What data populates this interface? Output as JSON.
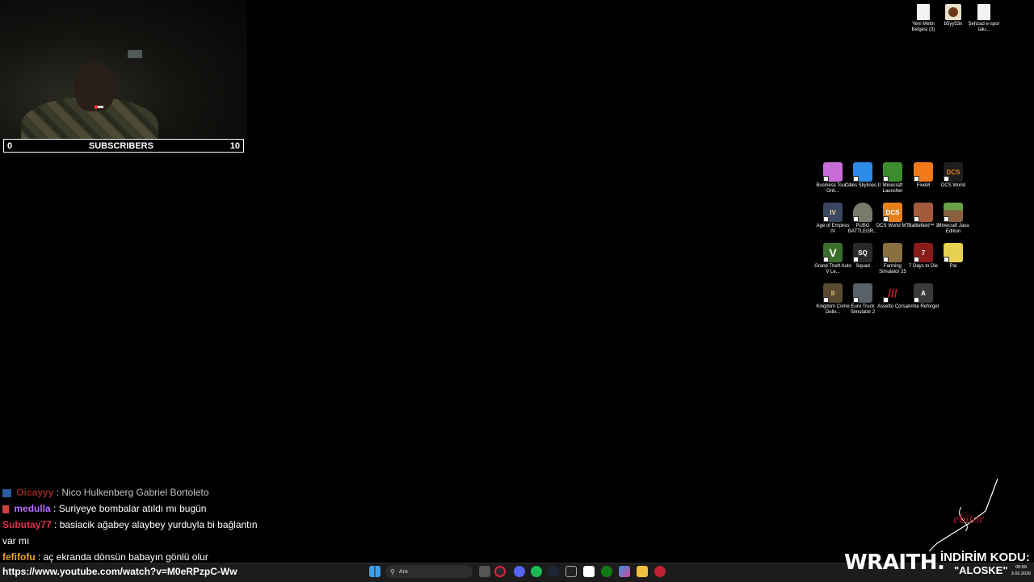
{
  "stream": {
    "subscribers": {
      "current": "0",
      "label": "SUBSCRIBERS",
      "goal": "10"
    }
  },
  "desktop_top_icons": [
    {
      "label": "Yeni Metin Belgesi (3)",
      "icon": "text-document-icon"
    },
    {
      "label": "b5yy53n",
      "icon": "avatar-icon"
    },
    {
      "label": "Şehzad e-spor takı...",
      "icon": "text-document-icon"
    }
  ],
  "desktop_icons": [
    {
      "label": "Business Tour - Onli...",
      "color": "#c86dd7"
    },
    {
      "label": "Cities Skylines II",
      "color": "#2b8be6"
    },
    {
      "label": "Minecraft Launcher",
      "color": "#3c8c2e"
    },
    {
      "label": "FiveM",
      "color": "#f07a1a"
    },
    {
      "label": "DCS World",
      "color": "#1e1e1e"
    },
    {
      "label": "Age of Empires IV",
      "color": "#3b4760"
    },
    {
      "label": "PUBG BATTLEGR...",
      "color": "#7a7a6a"
    },
    {
      "label": "DCS World MT",
      "color": "#e8801a"
    },
    {
      "label": "Battlefield™ 1",
      "color": "#a65a3c"
    },
    {
      "label": "Minecraft Java Edition",
      "color": "#6ba04a"
    },
    {
      "label": "Grand Theft Auto V Le...",
      "color": "#3a6e2a"
    },
    {
      "label": "Squad",
      "color": "#2a2a2a"
    },
    {
      "label": "Farming Simulator 25",
      "color": "#8a7040"
    },
    {
      "label": "7 Days to Die",
      "color": "#8b1a1a"
    },
    {
      "label": "Pal",
      "color": "#e8d050"
    },
    {
      "label": "Kingdom Come Deliv...",
      "color": "#5a4a30"
    },
    {
      "label": "Euro Truck Simulator 2",
      "color": "#5a6068"
    },
    {
      "label": "Assetto Corsa",
      "color": "#b01a2a"
    },
    {
      "label": "Arma Reforger",
      "color": "#3a3a3a"
    }
  ],
  "chat": [
    {
      "user": "Oicayyy",
      "user_color": "#c0392b",
      "message": ": Nico Hulkenberg Gabriel Bortoleto",
      "dim": true
    },
    {
      "user": "medulla",
      "user_color": "#b86bff",
      "message": ": Suriyeye bombalar atıldı mı bugün",
      "dim": false
    },
    {
      "user": "Subutay77",
      "user_color": "#e0314b",
      "message": ": basiacik ağabey alaybey yurduyla bi bağlantın var mı",
      "dim": false
    },
    {
      "user": "fefifofu",
      "user_color": "#f0a020",
      "message": ": aç ekranda dönsün babayın gönlü olur",
      "dim": false
    }
  ],
  "overlay_url": "https://www.youtube.com/watch?v=M0eRPzpC-Ww",
  "taskbar": {
    "search_placeholder": "Ara",
    "time": "00:59",
    "date": "3.02.2026"
  },
  "sponsor": {
    "brand": "WRAITH.",
    "discount_label": "İNDİRİM KODU:",
    "discount_code": "\"ALOSKE\""
  }
}
